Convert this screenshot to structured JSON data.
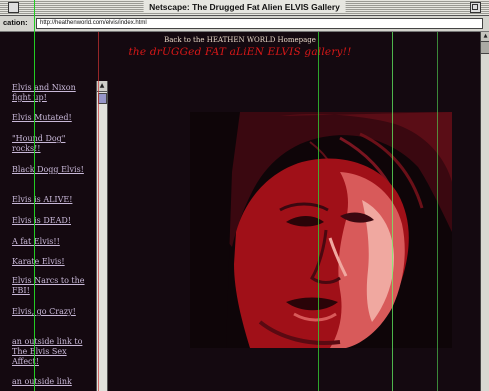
{
  "window": {
    "title": "Netscape: The Drugged Fat Alien ELVIS Gallery"
  },
  "location_bar": {
    "label": "cation:",
    "url": "http://heathenworld.com/elvis/index.html"
  },
  "page": {
    "back_link": "Back to the HEATHEN WORLD Homepage",
    "gallery_title": "the drUGGed FAT aLiEN ELVIS gallery!!"
  },
  "nav_links": [
    "Elvis and Nixon fight up!",
    "Elvis Mutated!",
    "\"Hound Dog\" rocks!!",
    "Black Dogg Elvis!",
    "Elvis is ALIVE!",
    "Elvis is DEAD!",
    "A fat Elvis!!",
    "Karate Elvis!",
    "Elvis Narcs to the FBI!",
    "Elvis, go Crazy!",
    "an outside link to The Elvis Sex Affect!",
    "an outside link"
  ],
  "colors": {
    "page_background": "#140910",
    "title_red": "#d81818",
    "link_color": "#c8b8d8",
    "photo_red": "#c01818"
  }
}
